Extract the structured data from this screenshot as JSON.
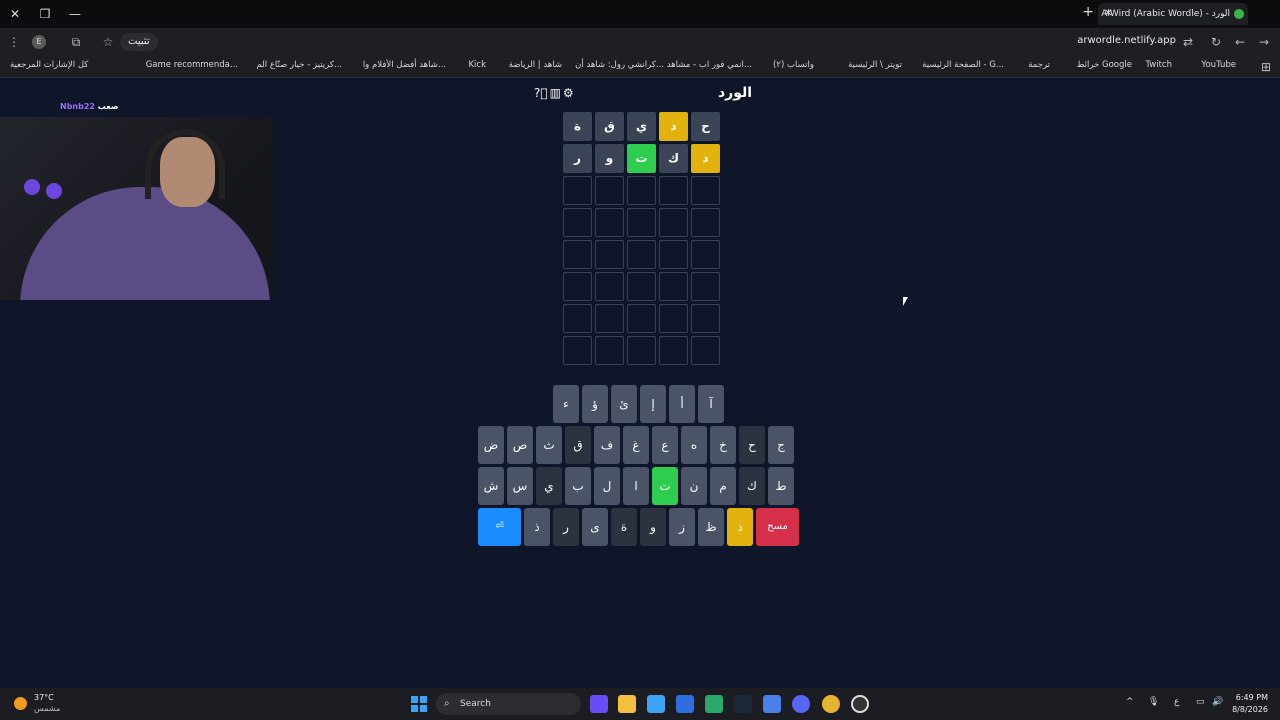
{
  "browser": {
    "tab_title": "AlWird (Arabic Wordle) - الورد",
    "url": "arwordle.netlify.app",
    "install_label": "تثبيت",
    "profile_letter": "E",
    "bookmarks": [
      "YouTube",
      "Twitch",
      "خرائط Google",
      "ترجمة",
      "الصفحة الرئيسية - G...",
      "تويتر \\ الرئيسية",
      "(٢) واتساب",
      "انمي فور اب - مشاهد...",
      "كرانشي رول: شاهد أن...",
      "شاهد | الرياضة",
      "Kick",
      "شاهد أفضل الأفلام وا...",
      "كريتيز - خيار صنّاع الم...",
      "Game recommenda...",
      "كل الإشارات المرجعية"
    ]
  },
  "stream": {
    "streamer_label": "صعب",
    "streamer_name": "Nbnb22"
  },
  "game": {
    "title": "الورد",
    "icons": [
      "help-icon",
      "stats-icon",
      "settings-icon"
    ],
    "board": [
      [
        {
          "l": "ح",
          "s": "absent"
        },
        {
          "l": "د",
          "s": "present"
        },
        {
          "l": "ي",
          "s": "absent"
        },
        {
          "l": "ق",
          "s": "absent"
        },
        {
          "l": "ة",
          "s": "absent"
        }
      ],
      [
        {
          "l": "د",
          "s": "present"
        },
        {
          "l": "ك",
          "s": "absent"
        },
        {
          "l": "ت",
          "s": "correct"
        },
        {
          "l": "و",
          "s": "absent"
        },
        {
          "l": "ر",
          "s": "absent"
        }
      ],
      [
        {
          "l": "",
          "s": "empty"
        },
        {
          "l": "",
          "s": "empty"
        },
        {
          "l": "",
          "s": "empty"
        },
        {
          "l": "",
          "s": "empty"
        },
        {
          "l": "",
          "s": "empty"
        }
      ],
      [
        {
          "l": "",
          "s": "empty"
        },
        {
          "l": "",
          "s": "empty"
        },
        {
          "l": "",
          "s": "empty"
        },
        {
          "l": "",
          "s": "empty"
        },
        {
          "l": "",
          "s": "empty"
        }
      ],
      [
        {
          "l": "",
          "s": "empty"
        },
        {
          "l": "",
          "s": "empty"
        },
        {
          "l": "",
          "s": "empty"
        },
        {
          "l": "",
          "s": "empty"
        },
        {
          "l": "",
          "s": "empty"
        }
      ],
      [
        {
          "l": "",
          "s": "empty"
        },
        {
          "l": "",
          "s": "empty"
        },
        {
          "l": "",
          "s": "empty"
        },
        {
          "l": "",
          "s": "empty"
        },
        {
          "l": "",
          "s": "empty"
        }
      ],
      [
        {
          "l": "",
          "s": "empty"
        },
        {
          "l": "",
          "s": "empty"
        },
        {
          "l": "",
          "s": "empty"
        },
        {
          "l": "",
          "s": "empty"
        },
        {
          "l": "",
          "s": "empty"
        }
      ],
      [
        {
          "l": "",
          "s": "empty"
        },
        {
          "l": "",
          "s": "empty"
        },
        {
          "l": "",
          "s": "empty"
        },
        {
          "l": "",
          "s": "empty"
        },
        {
          "l": "",
          "s": "empty"
        }
      ]
    ],
    "keyboard": [
      [
        {
          "k": "آ",
          "s": "normal"
        },
        {
          "k": "أ",
          "s": "normal"
        },
        {
          "k": "إ",
          "s": "normal"
        },
        {
          "k": "ئ",
          "s": "normal"
        },
        {
          "k": "ؤ",
          "s": "normal"
        },
        {
          "k": "ء",
          "s": "normal"
        }
      ],
      [
        {
          "k": "ج",
          "s": "normal"
        },
        {
          "k": "ح",
          "s": "absent"
        },
        {
          "k": "خ",
          "s": "normal"
        },
        {
          "k": "ه",
          "s": "normal"
        },
        {
          "k": "ع",
          "s": "normal"
        },
        {
          "k": "غ",
          "s": "normal"
        },
        {
          "k": "ف",
          "s": "normal"
        },
        {
          "k": "ق",
          "s": "absent"
        },
        {
          "k": "ث",
          "s": "normal"
        },
        {
          "k": "ص",
          "s": "normal"
        },
        {
          "k": "ض",
          "s": "normal"
        }
      ],
      [
        {
          "k": "ط",
          "s": "normal"
        },
        {
          "k": "ك",
          "s": "absent"
        },
        {
          "k": "م",
          "s": "normal"
        },
        {
          "k": "ن",
          "s": "normal"
        },
        {
          "k": "ت",
          "s": "correct"
        },
        {
          "k": "ا",
          "s": "normal"
        },
        {
          "k": "ل",
          "s": "normal"
        },
        {
          "k": "ب",
          "s": "normal"
        },
        {
          "k": "ي",
          "s": "absent"
        },
        {
          "k": "س",
          "s": "normal"
        },
        {
          "k": "ش",
          "s": "normal"
        }
      ],
      [
        {
          "k": "مسح",
          "s": "del"
        },
        {
          "k": "د",
          "s": "present"
        },
        {
          "k": "ظ",
          "s": "normal"
        },
        {
          "k": "ز",
          "s": "normal"
        },
        {
          "k": "و",
          "s": "absent"
        },
        {
          "k": "ة",
          "s": "absent"
        },
        {
          "k": "ى",
          "s": "normal"
        },
        {
          "k": "ر",
          "s": "absent"
        },
        {
          "k": "ذ",
          "s": "normal"
        },
        {
          "k": "⏎",
          "s": "enter"
        }
      ]
    ]
  },
  "taskbar": {
    "temperature": "37°C",
    "weather": "مشمس",
    "search_label": "Search",
    "lang": "ع",
    "time": "6:49 PM",
    "date": "8/8/2026"
  }
}
